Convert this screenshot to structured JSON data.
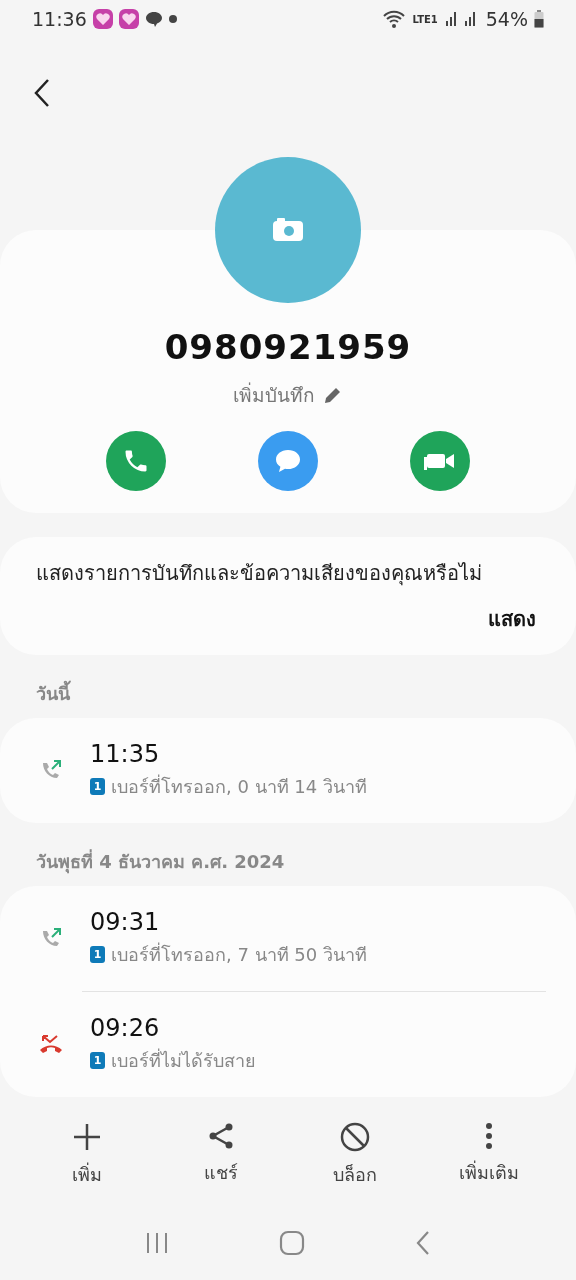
{
  "status_bar": {
    "time": "11:36",
    "notifications": [
      {
        "kind": "laz"
      },
      {
        "kind": "laz"
      },
      {
        "kind": "line"
      }
    ],
    "battery": "54%",
    "network": "LTE1"
  },
  "contact": {
    "number": "0980921959",
    "note_label": "เพิ่มบันทึก",
    "actions": [
      {
        "kind": "call"
      },
      {
        "kind": "message"
      },
      {
        "kind": "video"
      }
    ]
  },
  "prompt": {
    "text": "แสดงรายการบันทึกและข้อความเสียงของคุณหรือไม่",
    "button": "แสดง"
  },
  "groups": [
    {
      "date": "วันนี้",
      "calls": [
        {
          "kind": "outgoing",
          "time": "11:35",
          "sim": "1",
          "detail": "เบอร์ที่โทรออก, 0 นาที 14 วินาที"
        }
      ]
    },
    {
      "date": "วันพุธที่ 4 ธันวาคม ค.ศ. 2024",
      "calls": [
        {
          "kind": "outgoing",
          "time": "09:31",
          "sim": "1",
          "detail": "เบอร์ที่โทรออก, 7 นาที 50 วินาที"
        },
        {
          "kind": "missed",
          "time": "09:26",
          "sim": "1",
          "detail": "เบอร์ที่ไม่ได้รับสาย"
        }
      ]
    }
  ],
  "bottom_actions": [
    {
      "kind": "add",
      "label": "เพิ่ม"
    },
    {
      "kind": "share",
      "label": "แชร์"
    },
    {
      "kind": "block",
      "label": "บล็อก"
    },
    {
      "kind": "more",
      "label": "เพิ่มเติม"
    }
  ]
}
